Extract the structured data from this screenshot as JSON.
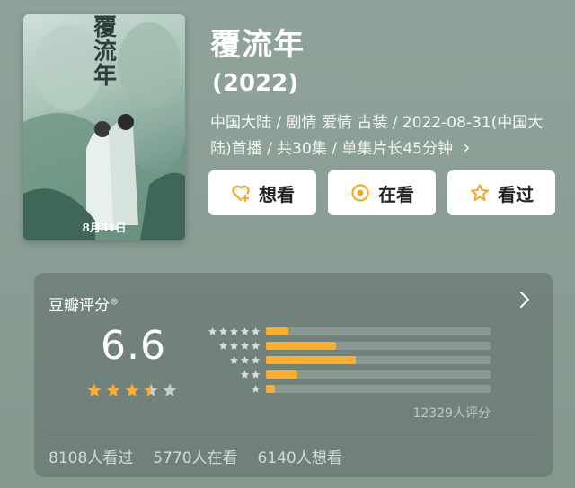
{
  "poster": {
    "title_chars": [
      "覆",
      "流",
      "年"
    ],
    "date": "8月31日"
  },
  "movie": {
    "title": "覆流年",
    "year": "(2022)",
    "meta": "中国大陆 / 剧情 爱情 古装 / 2022-08-31(中国大陆)首播 / 共30集 / 单集片长45分钟",
    "meta_arrow": "›"
  },
  "actions": [
    {
      "label": "想看",
      "icon": "heart-plus-icon"
    },
    {
      "label": "在看",
      "icon": "target-icon"
    },
    {
      "label": "看过",
      "icon": "star-outline-icon"
    }
  ],
  "rating": {
    "title": "豆瓣评分",
    "registered": "®",
    "score": "6.6",
    "star_level": 3.5,
    "distribution": [
      {
        "stars": 5,
        "fraction": 0.1
      },
      {
        "stars": 4,
        "fraction": 0.31
      },
      {
        "stars": 3,
        "fraction": 0.4
      },
      {
        "stars": 2,
        "fraction": 0.14
      },
      {
        "stars": 1,
        "fraction": 0.04
      }
    ],
    "count_text": "12329人评分",
    "stats": [
      "8108人看过",
      "5770人在看",
      "6140人想看"
    ]
  },
  "colors": {
    "accent": "#ffac2d",
    "star_empty": "#c8cfcc",
    "icon_orange": "#f5a623"
  }
}
